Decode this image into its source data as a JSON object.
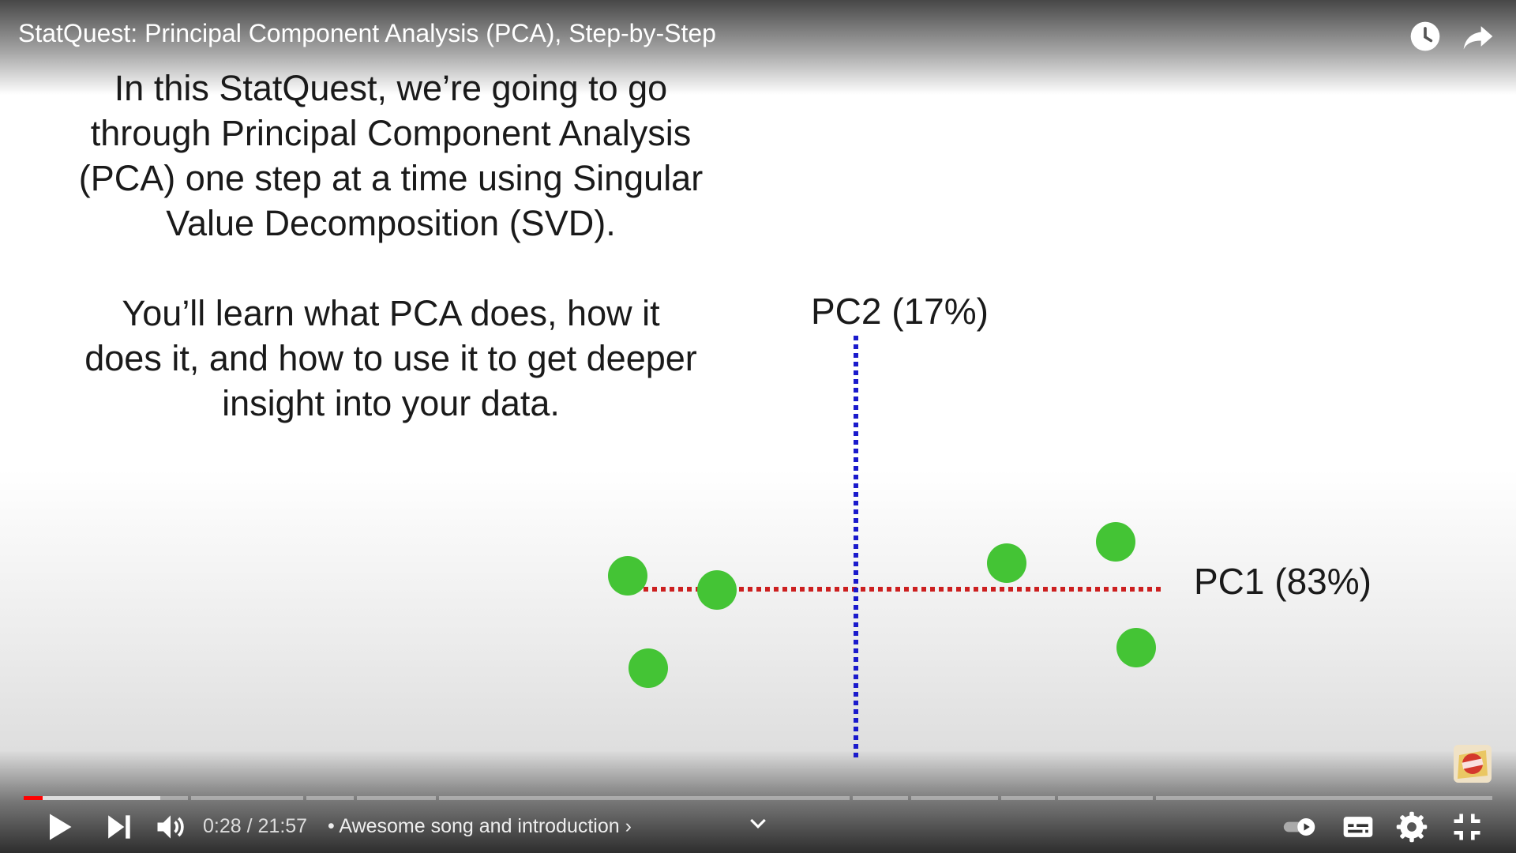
{
  "video": {
    "title": "StatQuest: Principal Component Analysis (PCA), Step-by-Step"
  },
  "slide": {
    "paragraph1": "In this StatQuest, we’re going to go\nthrough Principal Component Analysis\n(PCA) one step at a time using Singular\nValue Decomposition (SVD).",
    "paragraph2": "You’ll learn what PCA does, how it\ndoes it, and how to use it to get deeper\ninsight into your data."
  },
  "chart_data": {
    "type": "scatter",
    "xlabel": "PC1 (83%)",
    "ylabel": "PC2 (17%)",
    "colors": {
      "points": "#44c435",
      "pc1_axis": "#cc1f1f",
      "pc2_axis": "#1a1acc"
    }
  },
  "controls": {
    "current_time": "0:28",
    "separator": " / ",
    "duration": "21:57",
    "chapter_prefix": "•",
    "chapter_title": "Awesome song and introduction",
    "chapter_arrow": "›",
    "progress_played_fraction": 0.013,
    "progress_buffered_fraction": 0.093
  },
  "icons": {
    "top": [
      "watch-later-icon",
      "share-icon"
    ],
    "bottom_left": [
      "play-icon",
      "next-icon",
      "volume-icon"
    ],
    "bottom_right": [
      "autoplay-toggle-icon",
      "subtitles-icon",
      "settings-icon",
      "exit-fullscreen-icon"
    ]
  }
}
